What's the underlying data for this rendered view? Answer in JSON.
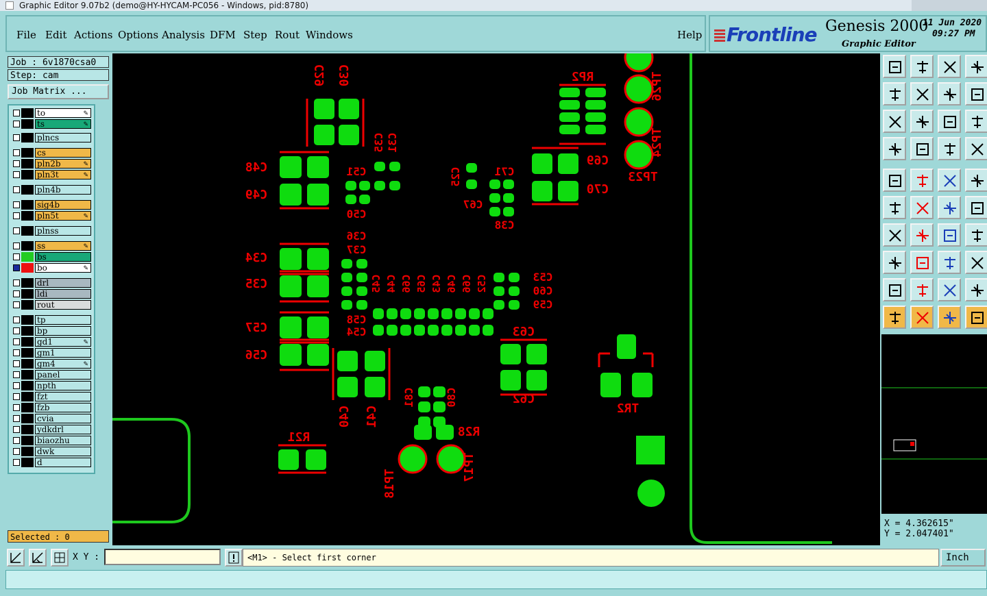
{
  "window": {
    "title": "Graphic Editor 9.07b2 (demo@HY-HYCAM-PC056 - Windows, pid:8780)"
  },
  "menu": {
    "file": "File",
    "edit": "Edit",
    "actions": "Actions",
    "options": "Options",
    "analysis": "Analysis",
    "dfm": "DFM",
    "step": "Step",
    "rout": "Rout",
    "windows": "Windows",
    "help": "Help"
  },
  "brand": {
    "logo": "Frontline",
    "product": "Genesis 2000",
    "subtitle": "Graphic Editor",
    "date": "11 Jun 2020",
    "time": "09:27 PM"
  },
  "job": {
    "job_label": "Job : 6v1870csa0",
    "step_label": "Step: cam",
    "matrix_button": "Job Matrix ..."
  },
  "layers": [
    {
      "name": "to",
      "color": "#ffffff",
      "swatch": "#000000",
      "edit": true
    },
    {
      "name": "ts",
      "color": "#18a878",
      "swatch": "#000000",
      "edit": true
    },
    {
      "name": "plncs",
      "color": "#b8e6e6",
      "swatch": "#000000",
      "edit": false
    },
    {
      "name": "cs",
      "color": "#f0b848",
      "swatch": "#000000",
      "edit": false
    },
    {
      "name": "pln2b",
      "color": "#f0b848",
      "swatch": "#000000",
      "edit": true
    },
    {
      "name": "pln3t",
      "color": "#f0b848",
      "swatch": "#000000",
      "edit": true
    },
    {
      "name": "pln4b",
      "color": "#b8e6e6",
      "swatch": "#000000",
      "edit": false
    },
    {
      "name": "sig4b",
      "color": "#f0b848",
      "swatch": "#000000",
      "edit": false
    },
    {
      "name": "pln5t",
      "color": "#f0b848",
      "swatch": "#000000",
      "edit": true
    },
    {
      "name": "plnss",
      "color": "#b8e6e6",
      "swatch": "#000000",
      "edit": false
    },
    {
      "name": "ss",
      "color": "#f0b848",
      "swatch": "#000000",
      "edit": true
    },
    {
      "name": "bs",
      "color": "#18a878",
      "swatch": "#22cc22",
      "edit": false
    },
    {
      "name": "bo",
      "color": "#ffffff",
      "swatch": "#ee1111",
      "edit": true
    },
    {
      "name": "drl",
      "color": "#a8b8c0",
      "swatch": "#000000",
      "edit": false
    },
    {
      "name": "ldi",
      "color": "#a8b8c0",
      "swatch": "#000000",
      "edit": false
    },
    {
      "name": "rout",
      "color": "#d8dcdc",
      "swatch": "#000000",
      "edit": false
    },
    {
      "name": "tp",
      "color": "#b8e6e6",
      "swatch": "#000000",
      "edit": false
    },
    {
      "name": "bp",
      "color": "#b8e6e6",
      "swatch": "#000000",
      "edit": false
    },
    {
      "name": "gd1",
      "color": "#b8e6e6",
      "swatch": "#000000",
      "edit": true
    },
    {
      "name": "gm1",
      "color": "#b8e6e6",
      "swatch": "#000000",
      "edit": false
    },
    {
      "name": "gm4",
      "color": "#b8e6e6",
      "swatch": "#000000",
      "edit": true
    },
    {
      "name": "panel",
      "color": "#b8e6e6",
      "swatch": "#000000",
      "edit": false
    },
    {
      "name": "npth",
      "color": "#b8e6e6",
      "swatch": "#000000",
      "edit": false
    },
    {
      "name": "fzt",
      "color": "#b8e6e6",
      "swatch": "#000000",
      "edit": false
    },
    {
      "name": "fzb",
      "color": "#b8e6e6",
      "swatch": "#000000",
      "edit": false
    },
    {
      "name": "cvia",
      "color": "#b8e6e6",
      "swatch": "#000000",
      "edit": false
    },
    {
      "name": "ydkdrl",
      "color": "#b8e6e6",
      "swatch": "#000000",
      "edit": false
    },
    {
      "name": "biaozhu",
      "color": "#b8e6e6",
      "swatch": "#000000",
      "edit": false
    },
    {
      "name": "dwk",
      "color": "#b8e6e6",
      "swatch": "#000000",
      "edit": false
    },
    {
      "name": "d",
      "color": "#b8e6e6",
      "swatch": "#000000",
      "edit": false
    }
  ],
  "selected": "Selected : 0",
  "coords": {
    "x": "X = 4.362615\"",
    "y": "Y = 2.047401\""
  },
  "status": {
    "xy_label": "X Y :",
    "xy_value": "",
    "message": "<M1> - Select first corner",
    "unit": "Inch"
  },
  "pcb": {
    "refs": [
      "C29",
      "C30",
      "RP2",
      "TP26",
      "TP24",
      "TP23",
      "C35",
      "C31",
      "C48",
      "C49",
      "C51",
      "C50",
      "C25",
      "C71",
      "C67",
      "C38",
      "C69",
      "C70",
      "C34",
      "C35",
      "C36",
      "C37",
      "C57",
      "C56",
      "C58",
      "C54",
      "C45",
      "C44",
      "C66",
      "C65",
      "C43",
      "C46",
      "C66",
      "C52",
      "C53",
      "C60",
      "C59",
      "C63",
      "C62",
      "C40",
      "C41",
      "C81",
      "C80",
      "R28",
      "R21",
      "TP18",
      "TP17",
      "TR2"
    ],
    "colors": {
      "pad": "#0fdc0f",
      "silk": "#ee0000",
      "outline": "#1ec81e"
    }
  }
}
